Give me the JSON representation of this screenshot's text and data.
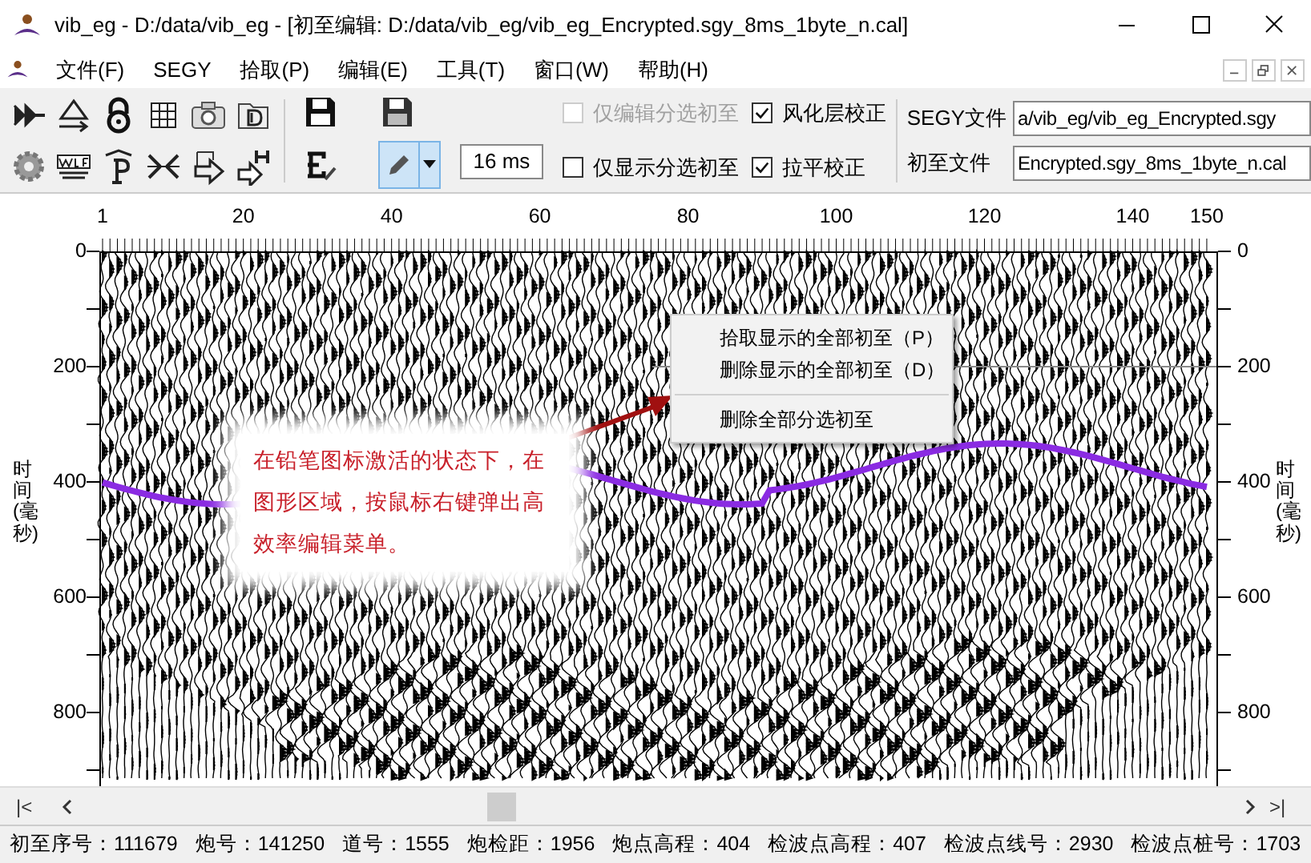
{
  "window": {
    "title": "vib_eg - D:/data/vib_eg - [初至编辑: D:/data/vib_eg/vib_eg_Encrypted.sgy_8ms_1byte_n.cal]"
  },
  "menu": [
    {
      "label": "文件(F)"
    },
    {
      "label": "SEGY"
    },
    {
      "label": "拾取(P)"
    },
    {
      "label": "编辑(E)"
    },
    {
      "label": "工具(T)"
    },
    {
      "label": "窗口(W)"
    },
    {
      "label": "帮助(H)"
    }
  ],
  "toolbar": {
    "pencil_selected": true,
    "interval": "16 ms",
    "checkboxes": [
      {
        "label": "仅编辑分选初至",
        "checked": false,
        "disabled": true
      },
      {
        "label": "风化层校正",
        "checked": true,
        "disabled": false
      },
      {
        "label": "仅显示分选初至",
        "checked": false,
        "disabled": false
      },
      {
        "label": "拉平校正",
        "checked": true,
        "disabled": false
      }
    ],
    "files": [
      {
        "label": "SEGY文件",
        "value": "a/vib_eg/vib_eg_Encrypted.sgy"
      },
      {
        "label": "初至文件",
        "value": "Encrypted.sgy_8ms_1byte_n.cal"
      }
    ]
  },
  "plot": {
    "top_ticks": [
      "1",
      "20",
      "40",
      "60",
      "80",
      "100",
      "120",
      "140",
      "150"
    ],
    "left_ticks": [
      "0",
      "200",
      "400",
      "600",
      "800"
    ],
    "right_ticks": [
      "0",
      "200",
      "400",
      "600",
      "800"
    ],
    "left_title": "时间(毫秒)",
    "right_title": "时间(毫秒)",
    "callout": "在铅笔图标激活的状态下，在图形区域，按鼠标右键弹出高效率编辑菜单。",
    "context_menu": [
      {
        "kind": "item",
        "label": "拾取显示的全部初至（P）"
      },
      {
        "kind": "item",
        "label": "删除显示的全部初至（D）"
      },
      {
        "kind": "separator"
      },
      {
        "kind": "item",
        "label": "删除全部分选初至"
      }
    ]
  },
  "scrollbar": {
    "first": "|<",
    "last": ">|"
  },
  "status_bar": [
    "初至序号：111679",
    "炮号：141250",
    "道号：1555",
    "炮检距：1956",
    "炮点高程：404",
    "检波点高程：407",
    "检波点线号：2930",
    "检波点桩号：1703"
  ]
}
